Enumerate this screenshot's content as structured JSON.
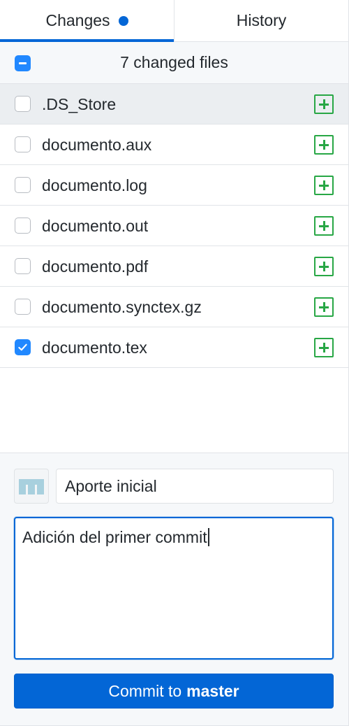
{
  "tabs": [
    {
      "label": "Changes",
      "selected": true,
      "has_indicator": true
    },
    {
      "label": "History",
      "selected": false
    }
  ],
  "files_header": {
    "select_all_state": "indeterminate",
    "title": "7 changed files"
  },
  "files": [
    {
      "name": ".DS_Store",
      "checked": false,
      "status": "added",
      "highlighted": true
    },
    {
      "name": "documento.aux",
      "checked": false,
      "status": "added"
    },
    {
      "name": "documento.log",
      "checked": false,
      "status": "added"
    },
    {
      "name": "documento.out",
      "checked": false,
      "status": "added"
    },
    {
      "name": "documento.pdf",
      "checked": false,
      "status": "added"
    },
    {
      "name": "documento.synctex.gz",
      "checked": false,
      "status": "added"
    },
    {
      "name": "documento.tex",
      "checked": true,
      "status": "added"
    }
  ],
  "commit": {
    "summary_value": "Aporte inicial",
    "description_value": "Adición del primer commit",
    "button_prefix": "Commit to",
    "branch": "master"
  },
  "icons": {
    "status": "plus-square-icon",
    "avatar": "user-avatar-icon",
    "checkbox_checked": "checkmark-icon",
    "checkbox_indeterminate": "minus-icon"
  },
  "colors": {
    "accent": "#0366d6",
    "checkbox": "#2188ff",
    "added": "#28a745",
    "highlight_row": "#ebeef1",
    "panel_bg": "#f6f8fa"
  }
}
